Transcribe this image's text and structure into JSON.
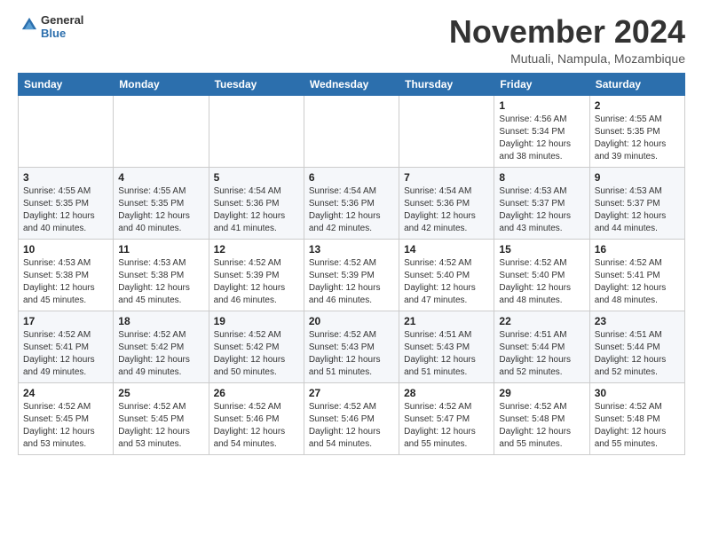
{
  "logo": {
    "general": "General",
    "blue": "Blue"
  },
  "header": {
    "month_title": "November 2024",
    "location": "Mutuali, Nampula, Mozambique"
  },
  "weekdays": [
    "Sunday",
    "Monday",
    "Tuesday",
    "Wednesday",
    "Thursday",
    "Friday",
    "Saturday"
  ],
  "weeks": [
    [
      {
        "day": "",
        "info": ""
      },
      {
        "day": "",
        "info": ""
      },
      {
        "day": "",
        "info": ""
      },
      {
        "day": "",
        "info": ""
      },
      {
        "day": "",
        "info": ""
      },
      {
        "day": "1",
        "info": "Sunrise: 4:56 AM\nSunset: 5:34 PM\nDaylight: 12 hours and 38 minutes."
      },
      {
        "day": "2",
        "info": "Sunrise: 4:55 AM\nSunset: 5:35 PM\nDaylight: 12 hours and 39 minutes."
      }
    ],
    [
      {
        "day": "3",
        "info": "Sunrise: 4:55 AM\nSunset: 5:35 PM\nDaylight: 12 hours and 40 minutes."
      },
      {
        "day": "4",
        "info": "Sunrise: 4:55 AM\nSunset: 5:35 PM\nDaylight: 12 hours and 40 minutes."
      },
      {
        "day": "5",
        "info": "Sunrise: 4:54 AM\nSunset: 5:36 PM\nDaylight: 12 hours and 41 minutes."
      },
      {
        "day": "6",
        "info": "Sunrise: 4:54 AM\nSunset: 5:36 PM\nDaylight: 12 hours and 42 minutes."
      },
      {
        "day": "7",
        "info": "Sunrise: 4:54 AM\nSunset: 5:36 PM\nDaylight: 12 hours and 42 minutes."
      },
      {
        "day": "8",
        "info": "Sunrise: 4:53 AM\nSunset: 5:37 PM\nDaylight: 12 hours and 43 minutes."
      },
      {
        "day": "9",
        "info": "Sunrise: 4:53 AM\nSunset: 5:37 PM\nDaylight: 12 hours and 44 minutes."
      }
    ],
    [
      {
        "day": "10",
        "info": "Sunrise: 4:53 AM\nSunset: 5:38 PM\nDaylight: 12 hours and 45 minutes."
      },
      {
        "day": "11",
        "info": "Sunrise: 4:53 AM\nSunset: 5:38 PM\nDaylight: 12 hours and 45 minutes."
      },
      {
        "day": "12",
        "info": "Sunrise: 4:52 AM\nSunset: 5:39 PM\nDaylight: 12 hours and 46 minutes."
      },
      {
        "day": "13",
        "info": "Sunrise: 4:52 AM\nSunset: 5:39 PM\nDaylight: 12 hours and 46 minutes."
      },
      {
        "day": "14",
        "info": "Sunrise: 4:52 AM\nSunset: 5:40 PM\nDaylight: 12 hours and 47 minutes."
      },
      {
        "day": "15",
        "info": "Sunrise: 4:52 AM\nSunset: 5:40 PM\nDaylight: 12 hours and 48 minutes."
      },
      {
        "day": "16",
        "info": "Sunrise: 4:52 AM\nSunset: 5:41 PM\nDaylight: 12 hours and 48 minutes."
      }
    ],
    [
      {
        "day": "17",
        "info": "Sunrise: 4:52 AM\nSunset: 5:41 PM\nDaylight: 12 hours and 49 minutes."
      },
      {
        "day": "18",
        "info": "Sunrise: 4:52 AM\nSunset: 5:42 PM\nDaylight: 12 hours and 49 minutes."
      },
      {
        "day": "19",
        "info": "Sunrise: 4:52 AM\nSunset: 5:42 PM\nDaylight: 12 hours and 50 minutes."
      },
      {
        "day": "20",
        "info": "Sunrise: 4:52 AM\nSunset: 5:43 PM\nDaylight: 12 hours and 51 minutes."
      },
      {
        "day": "21",
        "info": "Sunrise: 4:51 AM\nSunset: 5:43 PM\nDaylight: 12 hours and 51 minutes."
      },
      {
        "day": "22",
        "info": "Sunrise: 4:51 AM\nSunset: 5:44 PM\nDaylight: 12 hours and 52 minutes."
      },
      {
        "day": "23",
        "info": "Sunrise: 4:51 AM\nSunset: 5:44 PM\nDaylight: 12 hours and 52 minutes."
      }
    ],
    [
      {
        "day": "24",
        "info": "Sunrise: 4:52 AM\nSunset: 5:45 PM\nDaylight: 12 hours and 53 minutes."
      },
      {
        "day": "25",
        "info": "Sunrise: 4:52 AM\nSunset: 5:45 PM\nDaylight: 12 hours and 53 minutes."
      },
      {
        "day": "26",
        "info": "Sunrise: 4:52 AM\nSunset: 5:46 PM\nDaylight: 12 hours and 54 minutes."
      },
      {
        "day": "27",
        "info": "Sunrise: 4:52 AM\nSunset: 5:46 PM\nDaylight: 12 hours and 54 minutes."
      },
      {
        "day": "28",
        "info": "Sunrise: 4:52 AM\nSunset: 5:47 PM\nDaylight: 12 hours and 55 minutes."
      },
      {
        "day": "29",
        "info": "Sunrise: 4:52 AM\nSunset: 5:48 PM\nDaylight: 12 hours and 55 minutes."
      },
      {
        "day": "30",
        "info": "Sunrise: 4:52 AM\nSunset: 5:48 PM\nDaylight: 12 hours and 55 minutes."
      }
    ]
  ]
}
